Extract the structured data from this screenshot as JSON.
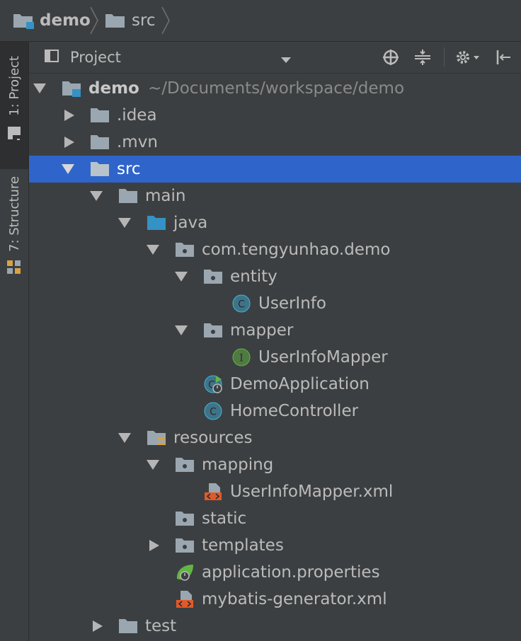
{
  "breadcrumb": {
    "items": [
      {
        "label": "demo",
        "icon": "module-folder-icon"
      },
      {
        "label": "src",
        "icon": "folder-icon"
      }
    ]
  },
  "stripe": {
    "tabs": [
      {
        "label": "1: Project",
        "icon": "project-icon",
        "active": true
      },
      {
        "label": "7: Structure",
        "icon": "structure-icon",
        "active": false
      }
    ]
  },
  "panel": {
    "view_label": "Project",
    "toolbar": [
      "locate-icon",
      "collapse-all-icon",
      "settings-icon",
      "hide-icon"
    ]
  },
  "tree": {
    "nodes": [
      {
        "label": "demo",
        "hint": "~/Documents/workspace/demo",
        "icon": "module-folder-icon",
        "expanded": true
      },
      {
        "label": ".idea",
        "icon": "folder-icon",
        "expanded": false
      },
      {
        "label": ".mvn",
        "icon": "folder-icon",
        "expanded": false
      },
      {
        "label": "src",
        "icon": "folder-icon",
        "expanded": true,
        "selected": true
      },
      {
        "label": "main",
        "icon": "folder-icon",
        "expanded": true
      },
      {
        "label": "java",
        "icon": "source-folder-icon",
        "expanded": true
      },
      {
        "label": "com.tengyunhao.demo",
        "icon": "package-icon",
        "expanded": true
      },
      {
        "label": "entity",
        "icon": "package-icon",
        "expanded": true
      },
      {
        "label": "UserInfo",
        "icon": "class-icon",
        "badge": "C"
      },
      {
        "label": "mapper",
        "icon": "package-icon",
        "expanded": true
      },
      {
        "label": "UserInfoMapper",
        "icon": "interface-icon",
        "badge": "I"
      },
      {
        "label": "DemoApplication",
        "icon": "spring-boot-class-icon",
        "badge": "C"
      },
      {
        "label": "HomeController",
        "icon": "class-icon",
        "badge": "C"
      },
      {
        "label": "resources",
        "icon": "resources-folder-icon",
        "expanded": true
      },
      {
        "label": "mapping",
        "icon": "package-icon",
        "expanded": true
      },
      {
        "label": "UserInfoMapper.xml",
        "icon": "xml-file-icon"
      },
      {
        "label": "static",
        "icon": "package-icon"
      },
      {
        "label": "templates",
        "icon": "package-icon",
        "expanded": false
      },
      {
        "label": "application.properties",
        "icon": "spring-properties-icon"
      },
      {
        "label": "mybatis-generator.xml",
        "icon": "xml-file-icon"
      },
      {
        "label": "test",
        "icon": "folder-icon",
        "expanded": false
      }
    ]
  },
  "colors": {
    "background": "#3c3f41",
    "selection": "#2f65ca",
    "text": "#bbbbbb",
    "folder": "#9aa7b0",
    "source_folder": "#40b6e0",
    "class_badge": "#40b6e0",
    "interface_badge": "#62b543",
    "xml_badge": "#e05a2a"
  }
}
